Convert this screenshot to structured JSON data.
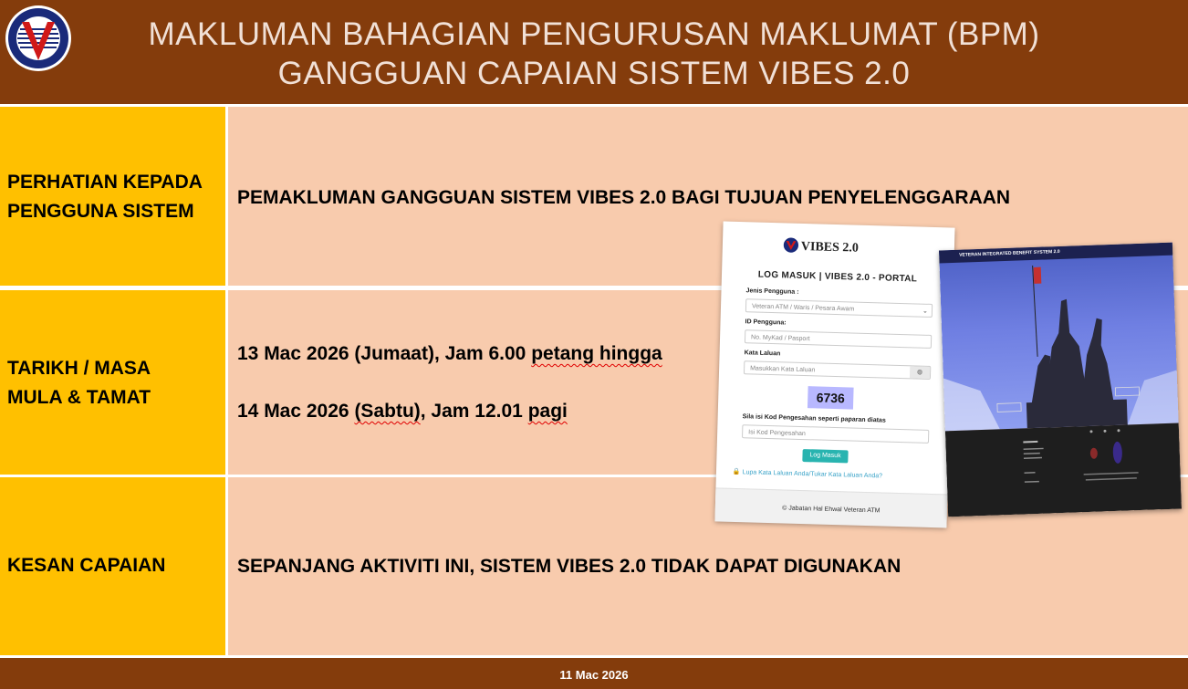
{
  "header": {
    "title_line1": "MAKLUMAN BAHAGIAN PENGURUSAN MAKLUMAT (BPM)",
    "title_line2": "GANGGUAN CAPAIAN SISTEM VIBES 2.0"
  },
  "rows": [
    {
      "label_line1": "PERHATIAN KEPADA",
      "label_line2": "PENGGUNA SISTEM",
      "content": "PEMAKLUMAN GANGGUAN SISTEM VIBES 2.0 BAGI TUJUAN PENYELENGGARAAN"
    },
    {
      "label_line1": "TARIKH / MASA",
      "label_line2": "MULA & TAMAT",
      "content_line1_a": "13 Mac 2026 (Jumaat), Jam 6.00 ",
      "content_line1_b": "petang hingga",
      "content_line2_a": "14 Mac 2026 ",
      "content_line2_b": "(Sabtu)",
      "content_line2_c": ", Jam 12.01 ",
      "content_line2_d": "pagi"
    },
    {
      "label_line1": "KESAN CAPAIAN",
      "content": "SEPANJANG AKTIVITI INI, SISTEM VIBES 2.0 TIDAK DAPAT DIGUNAKAN"
    }
  ],
  "login_panel": {
    "brand": "VIBES 2.0",
    "title": "LOG MASUK | VIBES 2.0 - PORTAL",
    "user_type_label": "Jenis Pengguna :",
    "user_type_value": "Veteran ATM / Waris / Pesara Awam",
    "user_id_label": "ID Pengguna:",
    "user_id_placeholder": "No. MyKad / Pasport",
    "password_label": "Kata Laluan",
    "password_placeholder": "Masukkan Kata Laluan",
    "captcha_code": "6736",
    "captcha_label": "Sila isi Kod Pengesahan seperti paparan diatas",
    "captcha_placeholder": "Isi Kod Pengesahan",
    "login_button": "Log Masuk",
    "forgot_link": "Lupa Kata Laluan Anda/Tukar Kata Laluan Anda?",
    "footer": "© Jabatan Hal Ehwal Veteran ATM"
  },
  "portal_screenshot": {
    "nav_title": "VETERAN INTEGRATED BENEFIT SYSTEM 2.0"
  },
  "footer": {
    "date": "11 Mac 2026"
  },
  "colors": {
    "brown": "#843c0c",
    "gold": "#ffc000",
    "peach": "#f8cbad"
  }
}
